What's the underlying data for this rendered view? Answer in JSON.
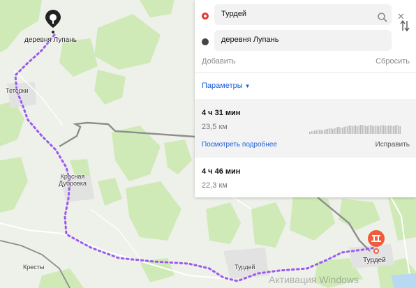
{
  "route_panel": {
    "from_value": "Турдей",
    "to_value": "деревня Лупань",
    "add_label": "Добавить",
    "reset_label": "Сбросить",
    "params_label": "Параметры",
    "routes": [
      {
        "time": "4 ч 31 мин",
        "distance": "23,5 км",
        "details_link": "Посмотреть подробнее",
        "fix_link": "Исправить",
        "selected": true
      },
      {
        "time": "4 ч 46 мин",
        "distance": "22,3 км",
        "selected": false
      }
    ]
  },
  "map_labels": {
    "start_place": "деревня Лупань",
    "teterki": "Тетерки",
    "krasnaya_dubrovka": "Красная\nДубровка",
    "kresty": "Кресты",
    "turdey_road": "Турдей",
    "turdey_end": "Турдей"
  },
  "watermark": "Активация Windows",
  "colors": {
    "route": "#9b59f0",
    "accent_link": "#1a5edb",
    "from_marker": "#e8362c",
    "end_marker": "#ef5b3c",
    "forest": "#cfeab6",
    "map_bg": "#eef0ea"
  },
  "icons": {
    "start_pin": "map-pin-black",
    "end_pin": "walking-pedestrian-orange",
    "search": "search-icon",
    "clear": "close-icon",
    "swap": "swap-arrows-icon"
  }
}
